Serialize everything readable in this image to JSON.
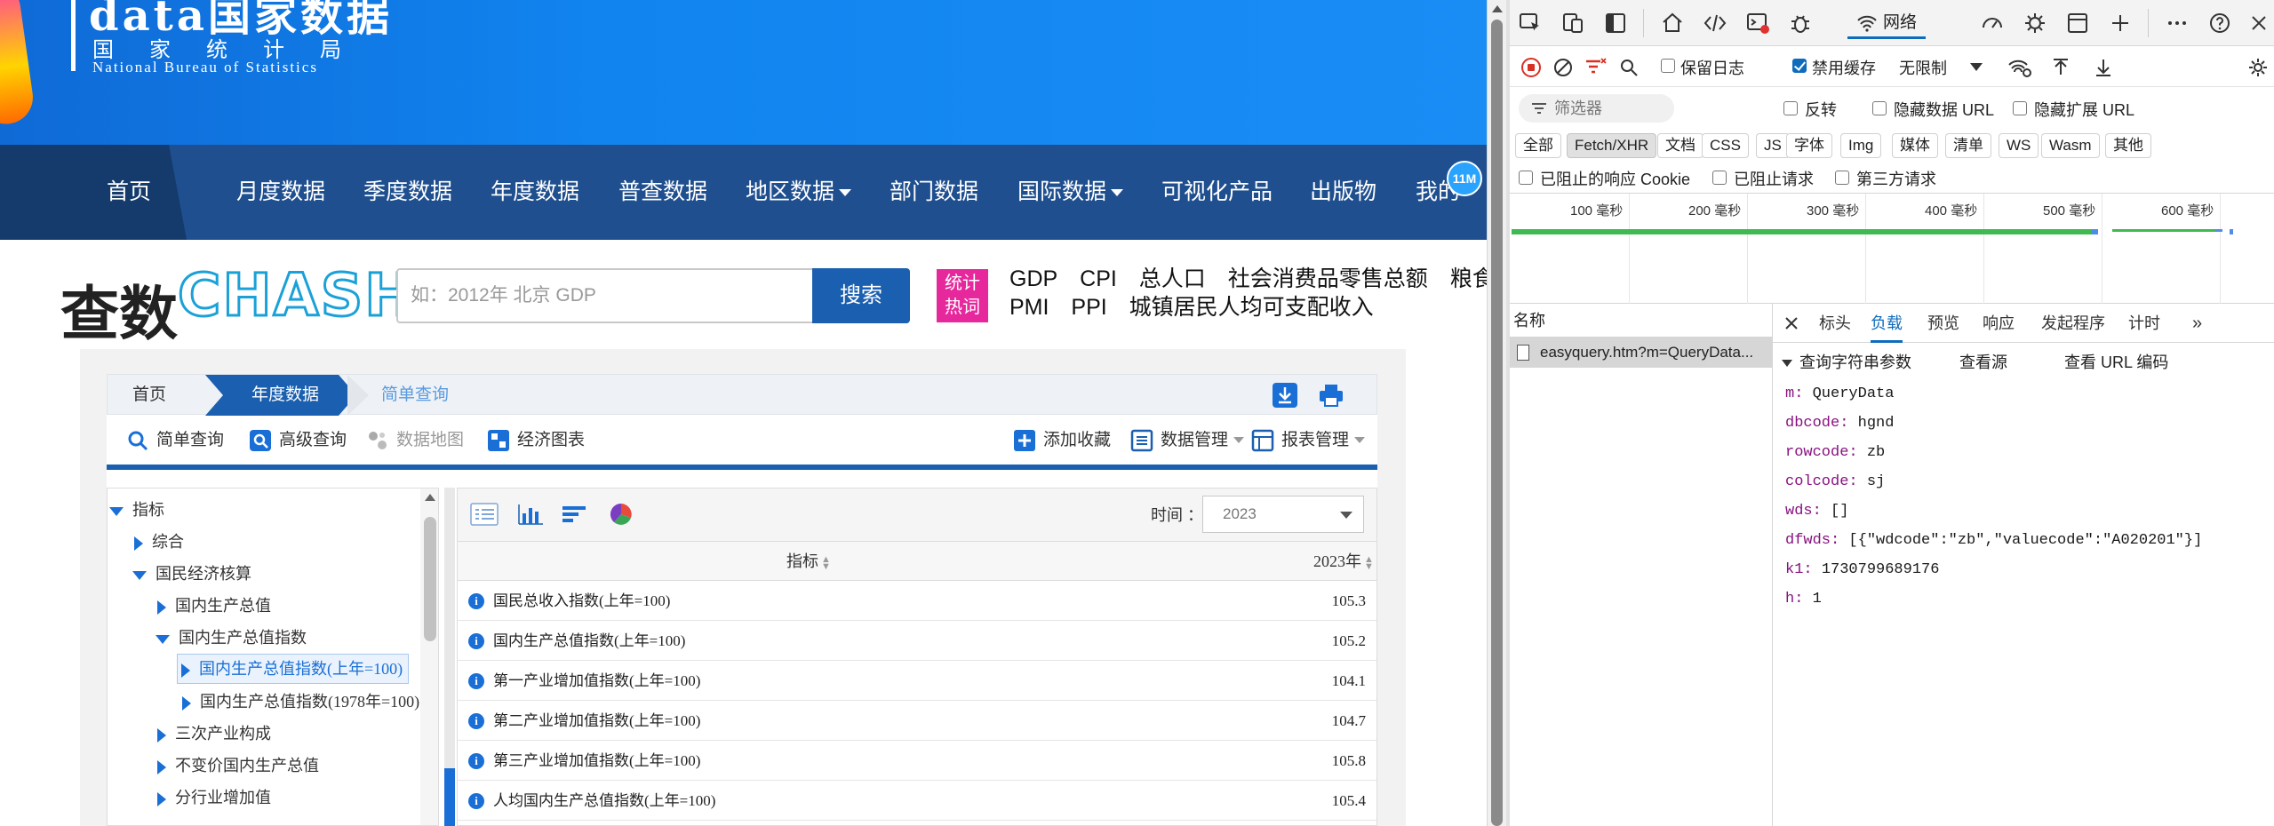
{
  "site": {
    "brand_top": "data国家数据",
    "brand_cn": "国家统计局",
    "brand_en": "National Bureau of Statistics",
    "nav": {
      "items": [
        "首页",
        "月度数据",
        "季度数据",
        "年度数据",
        "普查数据",
        "地区数据",
        "部门数据",
        "国际数据",
        "可视化产品",
        "出版物",
        "我的"
      ],
      "badge": "11M"
    },
    "search": {
      "logo_cn": "查数",
      "logo_en": "CHASHU",
      "placeholder": "如：2012年 北京 GDP",
      "button": "搜索",
      "hot_badge_1": "统计",
      "hot_badge_2": "热词",
      "hot_line1": [
        "GDP",
        "CPI",
        "总人口",
        "社会消费品零售总额",
        "粮食产量"
      ],
      "hot_line2": [
        "PMI",
        "PPI",
        "城镇居民人均可支配收入"
      ]
    },
    "breadcrumb": [
      "首页",
      "年度数据",
      "简单查询"
    ],
    "tools": {
      "simple": "简单查询",
      "advanced": "高级查询",
      "map": "数据地图",
      "chart": "经济图表",
      "favorite": "添加收藏",
      "data_mgmt": "数据管理",
      "report_mgmt": "报表管理"
    },
    "tree": [
      "指标",
      "综合",
      "国民经济核算",
      "国内生产总值",
      "国内生产总值指数",
      "国内生产总值指数(上年=100)",
      "国内生产总值指数(1978年=100)",
      "三次产业构成",
      "不变价国内生产总值",
      "分行业增加值"
    ],
    "table": {
      "time_label": "时间 ：",
      "time_value": "2023",
      "col_indicator": "指标",
      "col_year": "2023年",
      "rows": [
        {
          "name": "国民总收入指数(上年=100)",
          "value": "105.3"
        },
        {
          "name": "国内生产总值指数(上年=100)",
          "value": "105.2"
        },
        {
          "name": "第一产业增加值指数(上年=100)",
          "value": "104.1"
        },
        {
          "name": "第二产业增加值指数(上年=100)",
          "value": "104.7"
        },
        {
          "name": "第三产业增加值指数(上年=100)",
          "value": "105.8"
        },
        {
          "name": "人均国内生产总值指数(上年=100)",
          "value": "105.4"
        }
      ]
    }
  },
  "devtools": {
    "tab_network": "网络",
    "preserve_log": "保留日志",
    "disable_cache": "禁用缓存",
    "throttle": "无限制",
    "filter_placeholder": "筛选器",
    "invert": "反转",
    "hide_data_url": "隐藏数据 URL",
    "hide_ext_url": "隐藏扩展 URL",
    "types": [
      "全部",
      "Fetch/XHR",
      "文档",
      "CSS",
      "JS",
      "字体",
      "Img",
      "媒体",
      "清单",
      "WS",
      "Wasm",
      "其他"
    ],
    "blocked_cookies": "已阻止的响应 Cookie",
    "blocked_requests": "已阻止请求",
    "third_party": "第三方请求",
    "timeline_labels": [
      "100 毫秒",
      "200 毫秒",
      "300 毫秒",
      "400 毫秒",
      "500 毫秒",
      "600 毫秒"
    ],
    "name_header": "名称",
    "request_name": "easyquery.htm?m=QueryData...",
    "detail_tabs": [
      "标头",
      "负载",
      "预览",
      "响应",
      "发起程序",
      "计时"
    ],
    "qs_title": "查询字符串参数",
    "view_source": "查看源",
    "view_url_encoded": "查看 URL 编码",
    "params": [
      {
        "k": "m:",
        "v": "QueryData"
      },
      {
        "k": "dbcode:",
        "v": "hgnd"
      },
      {
        "k": "rowcode:",
        "v": "zb"
      },
      {
        "k": "colcode:",
        "v": "sj"
      },
      {
        "k": "wds:",
        "v": "[]"
      },
      {
        "k": "dfwds:",
        "v": "[{\"wdcode\":\"zb\",\"valuecode\":\"A020201\"}]"
      },
      {
        "k": "k1:",
        "v": "1730799689176"
      },
      {
        "k": "h:",
        "v": "1"
      }
    ]
  }
}
